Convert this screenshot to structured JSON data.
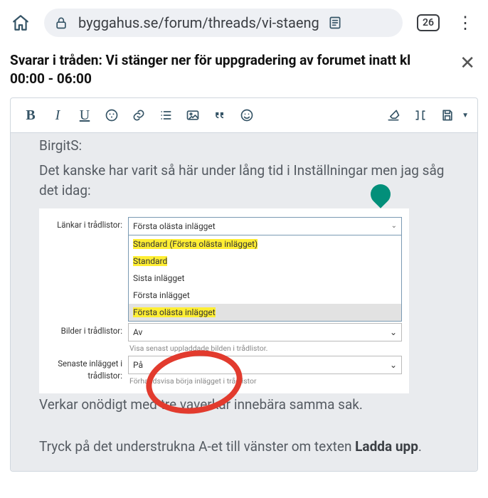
{
  "browser": {
    "url": "byggahus.se/forum/threads/vi-staeng",
    "tab_count": "26"
  },
  "header": {
    "title": "Svarar i tråden: Vi stänger ner för uppgradering av forumet inatt kl 00:00 - 06:00"
  },
  "editor": {
    "toolbar": {
      "bold": "B",
      "italic": "I",
      "underline": "U"
    },
    "quoted_name": "BirgitS:",
    "para1": "Det kanske har varit så här under lång tid i Inställningar men jag såg det idag:",
    "para2": "Verkar onödigt med tre vaverkar innebära samma sak.",
    "para3_pre": "Tryck på det understrukna A-et till vänster om texten ",
    "para3_bold": "Ladda upp",
    "para3_post": "."
  },
  "embedded": {
    "row1_label": "Länkar i trådlistor:",
    "row1_value": "Första olästa inlägget",
    "opts": {
      "o1": "Standard (Första olästa inlägget)",
      "o2": "Standard",
      "o3": "Sista inlägget",
      "o4": "Första inlägget",
      "o5": "Första olästa inlägget"
    },
    "row2_label": "Bilder i trådlistor:",
    "row2_value": "Av",
    "row2_help": "Visa senast uppladdade bilden i trådlistor.",
    "row3_label_a": "Senaste inlägget i",
    "row3_label_b": "trådlistor:",
    "row3_value": "På",
    "row3_help": "Förhandsvisa börja                       inlägget i trådlistor"
  }
}
